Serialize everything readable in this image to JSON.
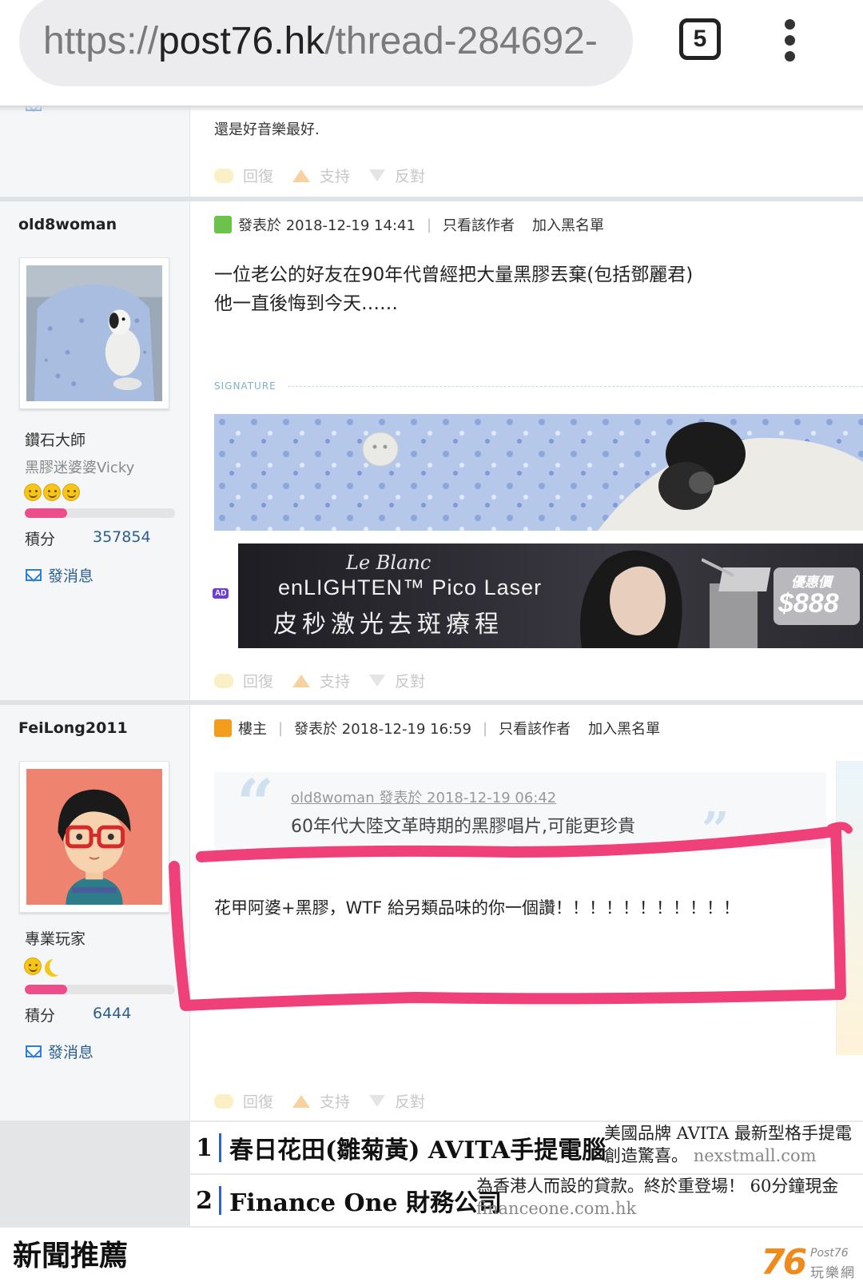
{
  "browser": {
    "url_proto": "https://",
    "url_host": "post76.hk",
    "url_path": "/thread-284692-",
    "tab_count": "5"
  },
  "post_prev": {
    "content": "還是好音樂最好."
  },
  "actions": {
    "reply": "回復",
    "support": "支持",
    "oppose": "反對"
  },
  "post1": {
    "username": "old8woman",
    "rank": "鑽石大師",
    "subtitle": "黑膠迷婆婆Vicky",
    "emoji_count": 3,
    "progress": 0.28,
    "points_label": "積分",
    "points": "357854",
    "send_msg": "發消息",
    "posted": "發表於 2018-12-19 14:41",
    "only_author": "只看該作者",
    "blacklist": "加入黑名單",
    "content_line1": "一位老公的好友在90年代曾經把大量黑膠丟棄(包括鄧麗君)",
    "content_line2": "他一直後悔到今天……",
    "signature_label": "SIGNATURE",
    "ad_tag": "AD",
    "ad_brand": "Le Blanc",
    "ad_line1": "enLIGHTEN™ Pico Laser",
    "ad_line2": "皮秒激光去斑療程",
    "ad_price_label": "優惠價",
    "ad_price": "$888"
  },
  "post2": {
    "username": "FeiLong2011",
    "rank": "專業玩家",
    "progress": 0.28,
    "points_label": "積分",
    "points": "6444",
    "send_msg": "發消息",
    "owner_badge": "樓主",
    "posted": "發表於 2018-12-19 16:59",
    "only_author": "只看該作者",
    "blacklist": "加入黑名單",
    "quote_author": "old8woman 發表於 2018-12-19 06:42",
    "quote_text": "60年代大陸文革時期的黑膠唱片,可能更珍貴",
    "content": "花甲阿婆+黑膠，WTF 給另類品味的你一個讚！！！！！！！！！！！"
  },
  "news": [
    {
      "num": "1",
      "title": "春日花田(雛菊黃) AVITA手提電腦",
      "desc1": "美國品牌 AVITA 最新型格手提電",
      "desc2": "創造驚喜。",
      "domain": "nexstmall.com"
    },
    {
      "num": "2",
      "title": "Finance One 財務公司",
      "desc1": "為香港人而設的貸款。終於重登場！ 60分鐘現金",
      "desc2": "",
      "domain": "financeone.com.hk"
    }
  ],
  "section_title": "新聞推薦",
  "logo": {
    "line1": "Post76",
    "line2": "玩樂網",
    "number": "76"
  },
  "colors": {
    "accent_link": "#2b5e8c",
    "highlight_pen": "#f0407a",
    "progress": "#ee4d8c"
  }
}
